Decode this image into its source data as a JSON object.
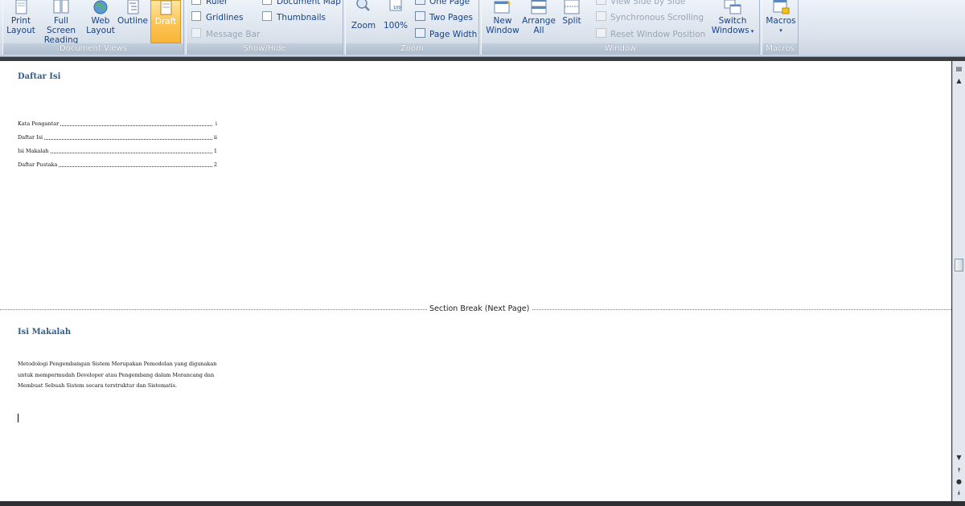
{
  "ribbon": {
    "document_views": {
      "label": "Document Views",
      "buttons": [
        "Print Layout",
        "Full Screen Reading",
        "Web Layout",
        "Outline",
        "Draft"
      ],
      "active": "Draft"
    },
    "show_hide": {
      "label": "Show/Hide",
      "ruler": "Ruler",
      "gridlines": "Gridlines",
      "message_bar": "Message Bar",
      "document_map": "Document Map",
      "thumbnails": "Thumbnails"
    },
    "zoom": {
      "label": "Zoom",
      "zoom": "Zoom",
      "hundred": "100%",
      "one_page": "One Page",
      "two_pages": "Two Pages",
      "page_width": "Page Width"
    },
    "window": {
      "label": "Window",
      "new_window": "New Window",
      "arrange_all": "Arrange All",
      "split": "Split",
      "view_side_by_side": "View Side by Side",
      "synchronous_scrolling": "Synchronous Scrolling",
      "reset_window_position": "Reset Window Position",
      "switch_windows": "Switch Windows"
    },
    "macros": {
      "label": "Macros",
      "macros": "Macros"
    }
  },
  "document": {
    "heading1": "Daftar Isi",
    "toc": [
      {
        "label": "Kata Pengantar",
        "page": "i"
      },
      {
        "label": "Daftar Isi",
        "page": "ii"
      },
      {
        "label": "Isi Makalah",
        "page": "1"
      },
      {
        "label": "Daftar Pustaka",
        "page": "2"
      }
    ],
    "section_break": "Section Break (Next Page)",
    "heading2": "Isi Makalah",
    "paragraph_lines": [
      "Metodologi Pengembangan Sistem Merupakan Pemodelan yang digunakan",
      "untuk mempermudah Developer atau Pengembang dalam Merancang dan",
      "Membuat Sebuah Sistem secara terstruktur dan Sistematis."
    ]
  },
  "colors": {
    "heading": "#2f5e8e",
    "ribbon_text": "#15428b",
    "active_button": "#fbc65a"
  }
}
